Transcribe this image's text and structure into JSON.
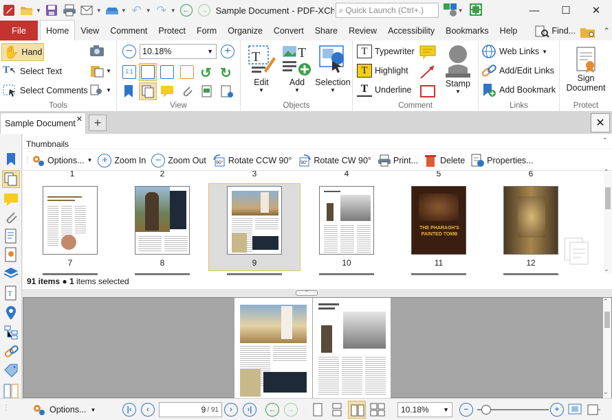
{
  "title_bar": {
    "document_title": "Sample Document - PDF-XCha...",
    "quick_launch_placeholder": "Quick Launch (Ctrl+.)"
  },
  "menu": {
    "file": "File",
    "tabs": [
      "Home",
      "View",
      "Comment",
      "Protect",
      "Form",
      "Organize",
      "Convert",
      "Share",
      "Review",
      "Accessibility",
      "Bookmarks",
      "Help"
    ],
    "find": "Find..."
  },
  "ribbon": {
    "tools": {
      "hand": "Hand",
      "select_text": "Select Text",
      "select_comments": "Select Comments",
      "label": "Tools"
    },
    "view": {
      "zoom": "10.18%",
      "label": "View"
    },
    "objects": {
      "edit": "Edit",
      "add": "Add",
      "selection": "Selection",
      "label": "Objects"
    },
    "comment": {
      "typewriter": "Typewriter",
      "highlight": "Highlight",
      "underline": "Underline",
      "stamp": "Stamp",
      "label": "Comment"
    },
    "links": {
      "web_links": "Web Links",
      "add_edit_links": "Add/Edit Links",
      "add_bookmark": "Add Bookmark",
      "label": "Links"
    },
    "protect": {
      "sign_line1": "Sign",
      "sign_line2": "Document",
      "label": "Protect"
    }
  },
  "document_tab": {
    "label": "Sample Document"
  },
  "thumbnails": {
    "header": "Thumbnails",
    "toolbar": {
      "options": "Options...",
      "zoom_in": "Zoom In",
      "zoom_out": "Zoom Out",
      "rotate_ccw": "Rotate CCW 90°",
      "rotate_cw": "Rotate CW 90°",
      "print": "Print...",
      "delete": "Delete",
      "properties": "Properties..."
    },
    "top_labels": [
      "1",
      "2",
      "3",
      "4",
      "5",
      "6"
    ],
    "pages": [
      "7",
      "8",
      "9",
      "10",
      "11",
      "12"
    ],
    "page5_title1": "THE PHARAOH'S",
    "page5_title2": "PAINTED TOMB",
    "status_count": "91 items",
    "status_selected": "1 items selected"
  },
  "bottom_bar": {
    "options": "Options...",
    "page_current": "9",
    "page_total": "/ 91",
    "zoom": "10.18%"
  },
  "colors": {
    "file_tab": "#c4332f",
    "accent": "#2f74c8",
    "selected": "#f3e0a8"
  }
}
